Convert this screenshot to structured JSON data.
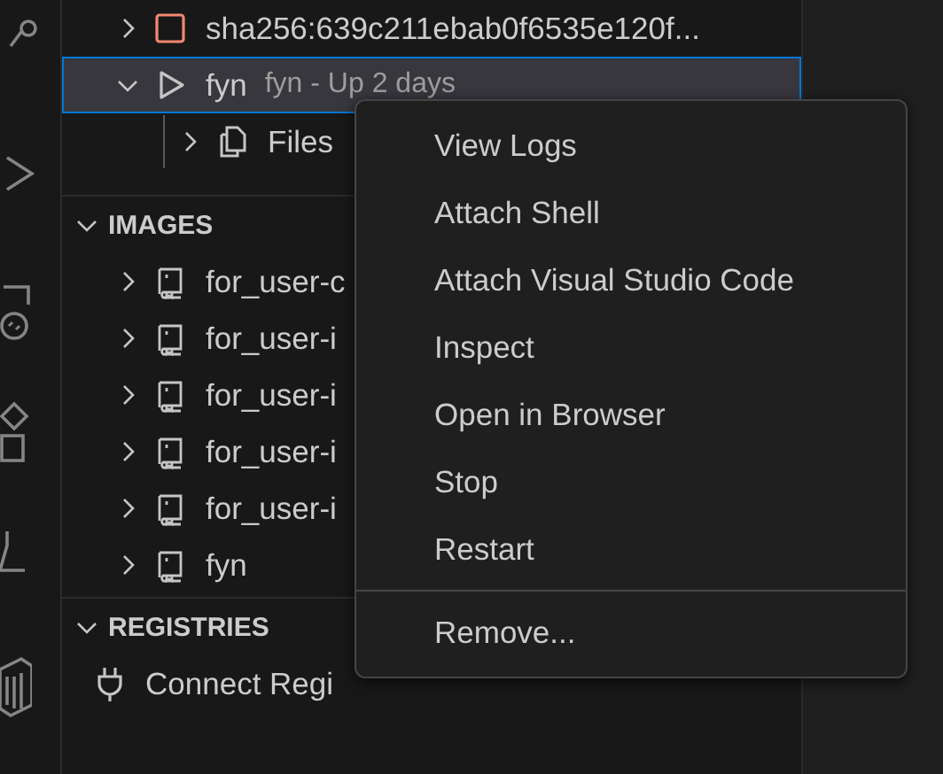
{
  "containers": {
    "items": [
      {
        "label": "sha256:639c211ebab0f6535e120f...",
        "kind": "stopped",
        "expanded": false,
        "selected": false
      },
      {
        "label": "fyn",
        "description": "fyn - Up 2 days",
        "kind": "running",
        "expanded": true,
        "selected": true,
        "children": [
          {
            "label": "Files",
            "kind": "files",
            "expanded": false,
            "selected": false
          }
        ]
      }
    ]
  },
  "sections": [
    {
      "title": "IMAGES",
      "expanded": true,
      "items": [
        {
          "label": "for_user-c",
          "kind": "image",
          "expanded": false
        },
        {
          "label": "for_user-i",
          "kind": "image",
          "expanded": false
        },
        {
          "label": "for_user-i",
          "kind": "image",
          "expanded": false
        },
        {
          "label": "for_user-i",
          "kind": "image",
          "expanded": false
        },
        {
          "label": "for_user-i",
          "kind": "image",
          "expanded": false
        },
        {
          "label": "fyn",
          "kind": "image",
          "expanded": false
        }
      ]
    },
    {
      "title": "REGISTRIES",
      "expanded": true,
      "items": [
        {
          "label": "Connect Regi",
          "kind": "connect"
        }
      ]
    }
  ],
  "context_menu": {
    "groups": [
      [
        "View Logs",
        "Attach Shell",
        "Attach Visual Studio Code",
        "Inspect",
        "Open in Browser",
        "Stop",
        "Restart"
      ],
      [
        "Remove..."
      ]
    ]
  }
}
